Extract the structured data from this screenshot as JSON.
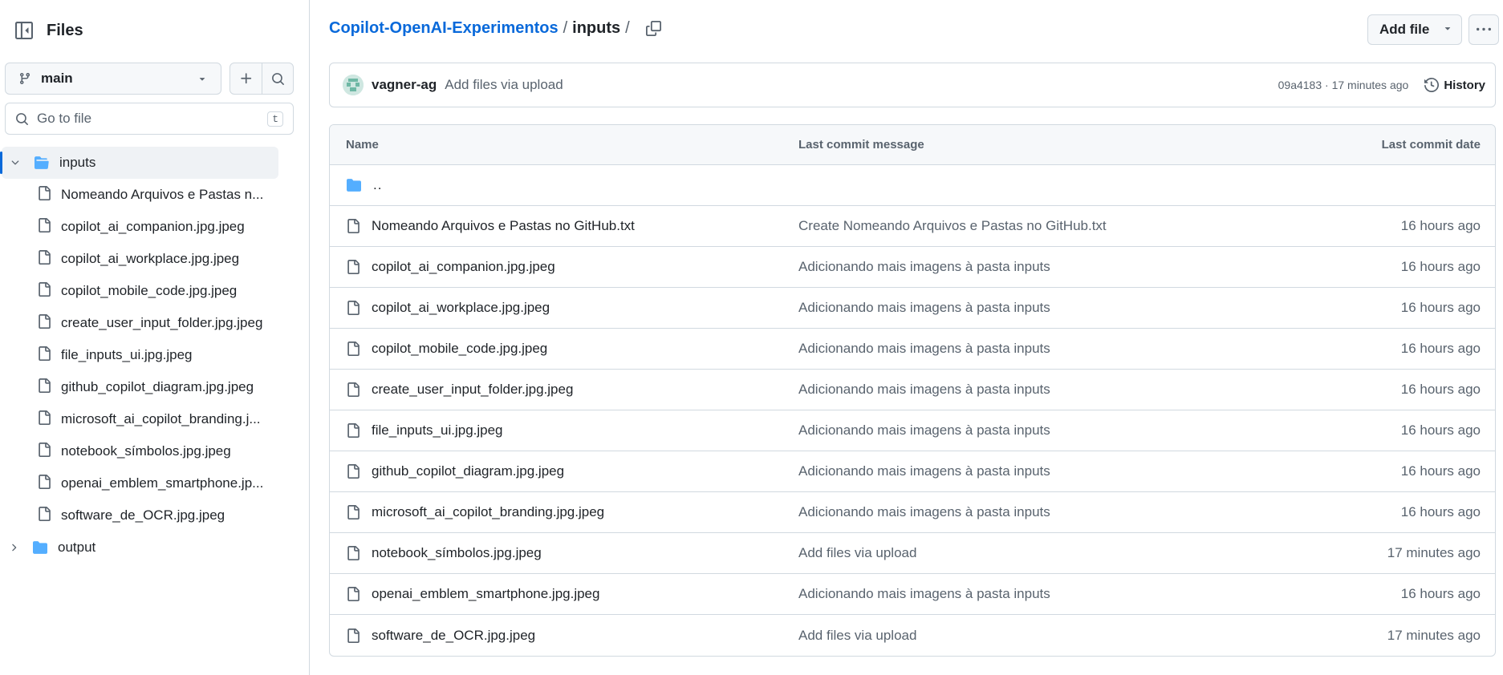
{
  "sidebar": {
    "title": "Files",
    "branch": "main",
    "search_placeholder": "Go to file",
    "search_shortcut": "t",
    "tree": {
      "open_folder": "inputs",
      "files": [
        "Nomeando Arquivos e Pastas n...",
        "copilot_ai_companion.jpg.jpeg",
        "copilot_ai_workplace.jpg.jpeg",
        "copilot_mobile_code.jpg.jpeg",
        "create_user_input_folder.jpg.jpeg",
        "file_inputs_ui.jpg.jpeg",
        "github_copilot_diagram.jpg.jpeg",
        "microsoft_ai_copilot_branding.j...",
        "notebook_símbolos.jpg.jpeg",
        "openai_emblem_smartphone.jp...",
        "software_de_OCR.jpg.jpeg"
      ],
      "closed_folder": "output"
    }
  },
  "breadcrumb": {
    "repo": "Copilot-OpenAI-Experimentos",
    "sep1": "/",
    "current": "inputs",
    "sep2": "/"
  },
  "header": {
    "add_file": "Add file"
  },
  "commit": {
    "author": "vagner-ag",
    "message": "Add files via upload",
    "meta": "09a4183 · 17 minutes ago",
    "history": "History"
  },
  "table": {
    "headers": {
      "name": "Name",
      "message": "Last commit message",
      "date": "Last commit date"
    },
    "updir": "..",
    "rows": [
      {
        "name": "Nomeando Arquivos e Pastas no GitHub.txt",
        "message": "Create Nomeando Arquivos e Pastas no GitHub.txt",
        "date": "16 hours ago"
      },
      {
        "name": "copilot_ai_companion.jpg.jpeg",
        "message": "Adicionando mais imagens à pasta inputs",
        "date": "16 hours ago"
      },
      {
        "name": "copilot_ai_workplace.jpg.jpeg",
        "message": "Adicionando mais imagens à pasta inputs",
        "date": "16 hours ago"
      },
      {
        "name": "copilot_mobile_code.jpg.jpeg",
        "message": "Adicionando mais imagens à pasta inputs",
        "date": "16 hours ago"
      },
      {
        "name": "create_user_input_folder.jpg.jpeg",
        "message": "Adicionando mais imagens à pasta inputs",
        "date": "16 hours ago"
      },
      {
        "name": "file_inputs_ui.jpg.jpeg",
        "message": "Adicionando mais imagens à pasta inputs",
        "date": "16 hours ago"
      },
      {
        "name": "github_copilot_diagram.jpg.jpeg",
        "message": "Adicionando mais imagens à pasta inputs",
        "date": "16 hours ago"
      },
      {
        "name": "microsoft_ai_copilot_branding.jpg.jpeg",
        "message": "Adicionando mais imagens à pasta inputs",
        "date": "16 hours ago"
      },
      {
        "name": "notebook_símbolos.jpg.jpeg",
        "message": "Add files via upload",
        "date": "17 minutes ago"
      },
      {
        "name": "openai_emblem_smartphone.jpg.jpeg",
        "message": "Adicionando mais imagens à pasta inputs",
        "date": "16 hours ago"
      },
      {
        "name": "software_de_OCR.jpg.jpeg",
        "message": "Add files via upload",
        "date": "17 minutes ago"
      }
    ]
  },
  "colors": {
    "link": "#0969da",
    "folder": "#54aeff",
    "muted": "#59636e",
    "border": "#d1d9e0"
  }
}
